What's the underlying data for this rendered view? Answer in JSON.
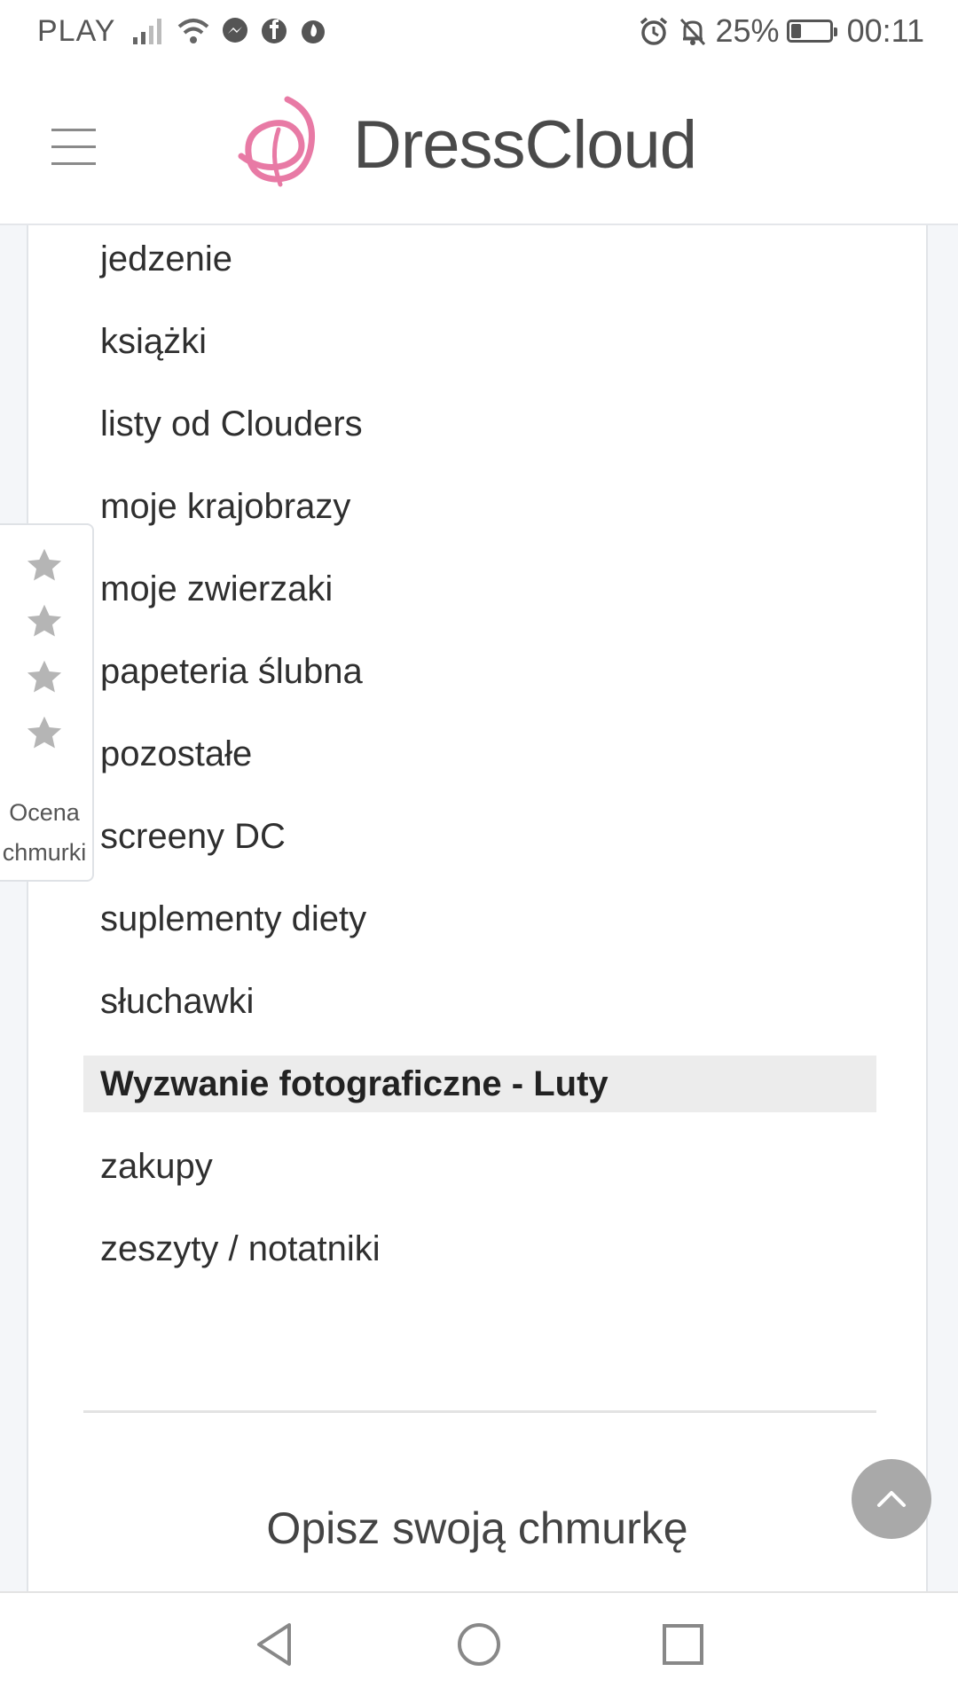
{
  "status_bar": {
    "carrier": "PLAY",
    "battery": "25%",
    "battery_level": 0.25,
    "time": "00:11",
    "icons": [
      "signal-icon",
      "wifi-icon",
      "messenger-icon",
      "facebook-icon",
      "flame-icon",
      "alarm-icon",
      "bell-off-icon",
      "battery-icon"
    ]
  },
  "header": {
    "menu_icon": "hamburger-menu-icon",
    "logo_text": "DressCloud",
    "logo_color": "#e87aa5"
  },
  "categories": [
    {
      "label": "jedzenie",
      "active": false
    },
    {
      "label": "książki",
      "active": false
    },
    {
      "label": "listy od Clouders",
      "active": false
    },
    {
      "label": "moje krajobrazy",
      "active": false
    },
    {
      "label": "moje zwierzaki",
      "active": false
    },
    {
      "label": "papeteria ślubna",
      "active": false
    },
    {
      "label": "pozostałe",
      "active": false
    },
    {
      "label": "screeny DC",
      "active": false
    },
    {
      "label": "suplementy diety",
      "active": false
    },
    {
      "label": "słuchawki",
      "active": false
    },
    {
      "label": "Wyzwanie fotograficzne - Luty",
      "active": true
    },
    {
      "label": "zakupy",
      "active": false
    },
    {
      "label": "zeszyty / notatniki",
      "active": false
    }
  ],
  "section": {
    "title": "Opisz swoją chmurkę"
  },
  "rating": {
    "stars": 4,
    "label_line1": "Ocena",
    "label_line2": "chmurki",
    "star_color": "#b5b5b5"
  },
  "scroll_top_icon": "chevron-up-icon",
  "nav": {
    "back_icon": "back-triangle-icon",
    "home_icon": "home-circle-icon",
    "recents_icon": "recents-square-icon"
  }
}
